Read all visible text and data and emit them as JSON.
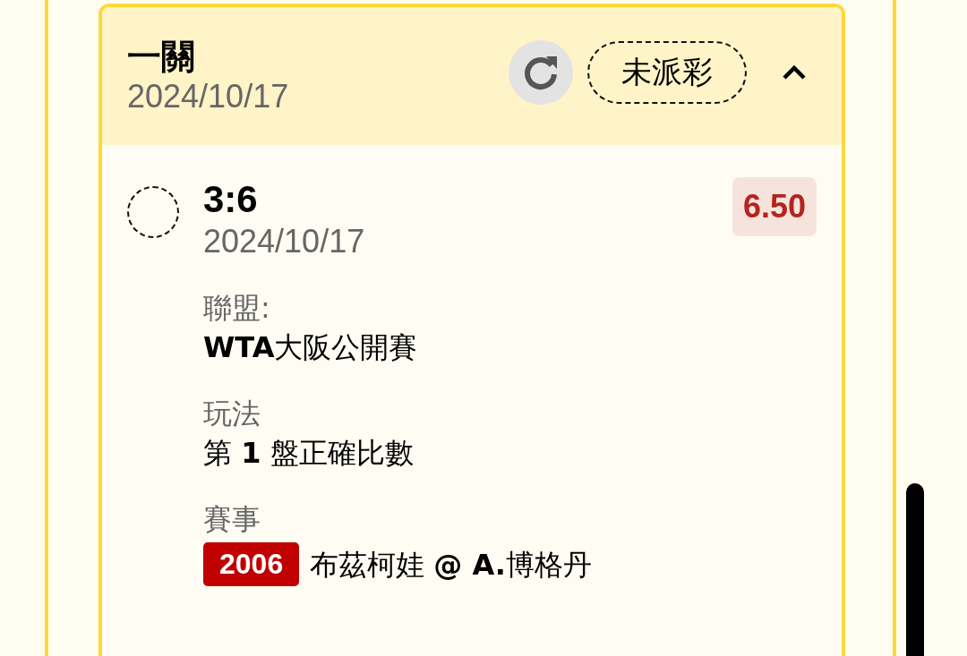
{
  "card": {
    "title": "一關",
    "date": "2024/10/17",
    "status": "未派彩",
    "expanded": true
  },
  "selection": {
    "selected": false,
    "score": "3:6",
    "date": "2024/10/17",
    "odds": "6.50"
  },
  "details": [
    {
      "kind": "text",
      "label": "聯盟:",
      "value": "**WTA**大阪公開賽"
    },
    {
      "kind": "text",
      "label": "玩法",
      "value": "第 **1** 盤正確比數"
    },
    {
      "kind": "event",
      "label": "賽事",
      "number": "2006",
      "value": "布茲柯娃 **@ A.**博格丹"
    }
  ]
}
